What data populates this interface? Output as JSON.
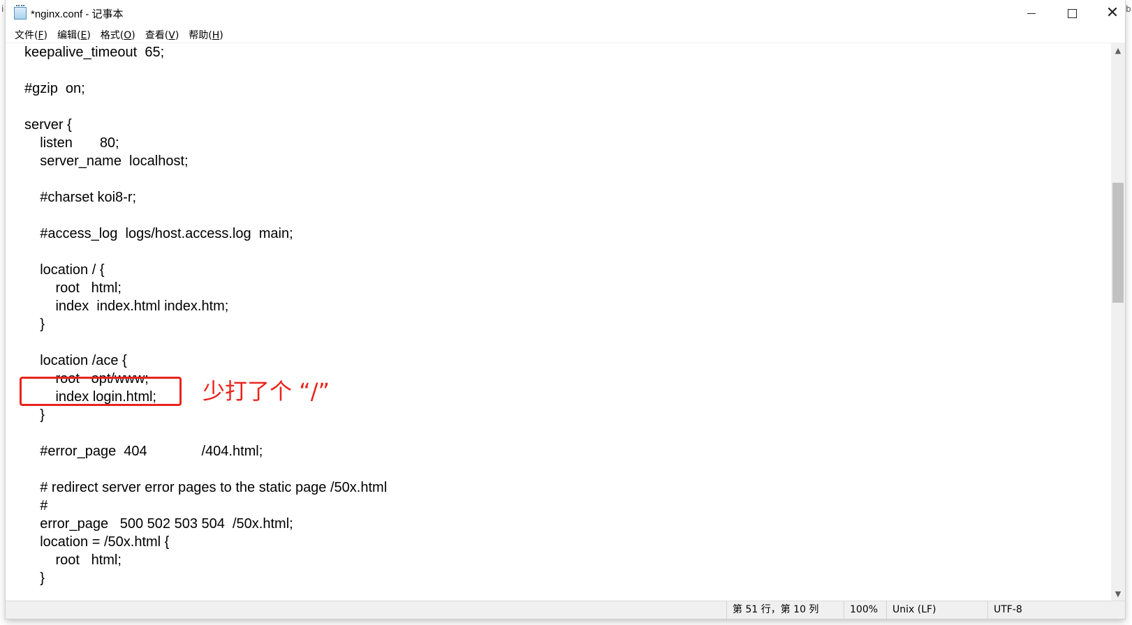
{
  "window": {
    "title": "*nginx.conf - 记事本",
    "icon": "notepad-icon",
    "controls": {
      "minimize": "minimize-icon",
      "maximize": "maximize-icon",
      "close": "close-icon"
    }
  },
  "menu": [
    {
      "label": "文件(",
      "key": "F",
      "end": ")"
    },
    {
      "label": "编辑(",
      "key": "E",
      "end": ")"
    },
    {
      "label": "格式(",
      "key": "O",
      "end": ")"
    },
    {
      "label": "查看(",
      "key": "V",
      "end": ")"
    },
    {
      "label": "帮助(",
      "key": "H",
      "end": ")"
    }
  ],
  "editor": {
    "lines": [
      "keepalive_timeout  65;",
      "",
      "#gzip  on;",
      "",
      "server {",
      "    listen       80;",
      "    server_name  localhost;",
      "",
      "    #charset koi8-r;",
      "",
      "    #access_log  logs/host.access.log  main;",
      "",
      "    location / {",
      "        root   html;",
      "        index  index.html index.htm;",
      "    }",
      "",
      "    location /ace {",
      "        root   opt/www;",
      "        index login.html;",
      "    }",
      "",
      "    #error_page  404              /404.html;",
      "",
      "    # redirect server error pages to the static page /50x.html",
      "    #",
      "    error_page   500 502 503 504  /50x.html;",
      "    location = /50x.html {",
      "        root   html;",
      "    }"
    ]
  },
  "annotation": {
    "text": "少打了个 “/”",
    "color": "#e8231b"
  },
  "statusbar": {
    "position": "第 51 行，第 10 列",
    "zoom": "100%",
    "line_ending": "Unix (LF)",
    "encoding": "UTF-8"
  },
  "background_fragments": {
    "top_left": "i",
    "top_right": "b"
  }
}
